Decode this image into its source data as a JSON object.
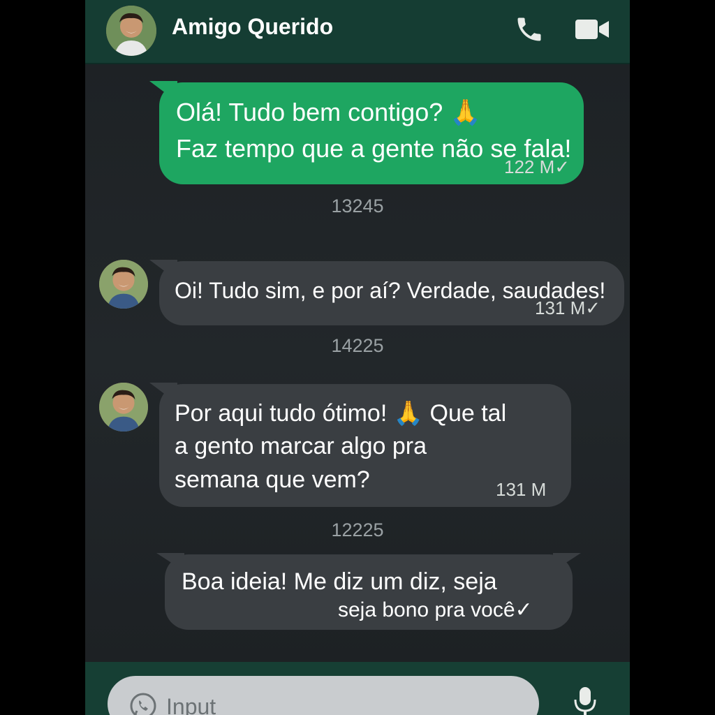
{
  "header": {
    "contact_name": "Amigo Querido",
    "avatar_icon": "contact-avatar",
    "call_icon": "phone-icon",
    "video_icon": "video-camera-icon"
  },
  "messages": [
    {
      "direction": "outgoing",
      "lines": [
        "Olá! Tudo bem contigo? 🙏",
        "Faz tempo que a gente não se fala!"
      ],
      "meta": "122 M✓"
    },
    {
      "direction": "incoming",
      "lines": [
        "Oi! Tudo sim, e por aí? Verdade, saudades!"
      ],
      "meta": "131 M✓"
    },
    {
      "direction": "incoming",
      "lines": [
        "Por aqui tudo ótimo! 🙏 Que tal",
        "a gento marcar algo pra",
        "semana que vem?"
      ],
      "meta": "131 M"
    },
    {
      "direction": "outgoing",
      "lines": [
        "Boa ideia! Me diz um diz, seja",
        "seja bono pra você✓"
      ],
      "meta": ""
    }
  ],
  "dividers": [
    "13245",
    "14225",
    "12225"
  ],
  "composer": {
    "placeholder": "Input",
    "input_icon": "whatsapp-icon",
    "mic_icon": "microphone-icon"
  },
  "colors": {
    "header_bg": "#153d33",
    "outgoing_bubble": "#1ea661",
    "incoming_bubble": "#3a3e42",
    "chat_bg": "#1f2326"
  }
}
